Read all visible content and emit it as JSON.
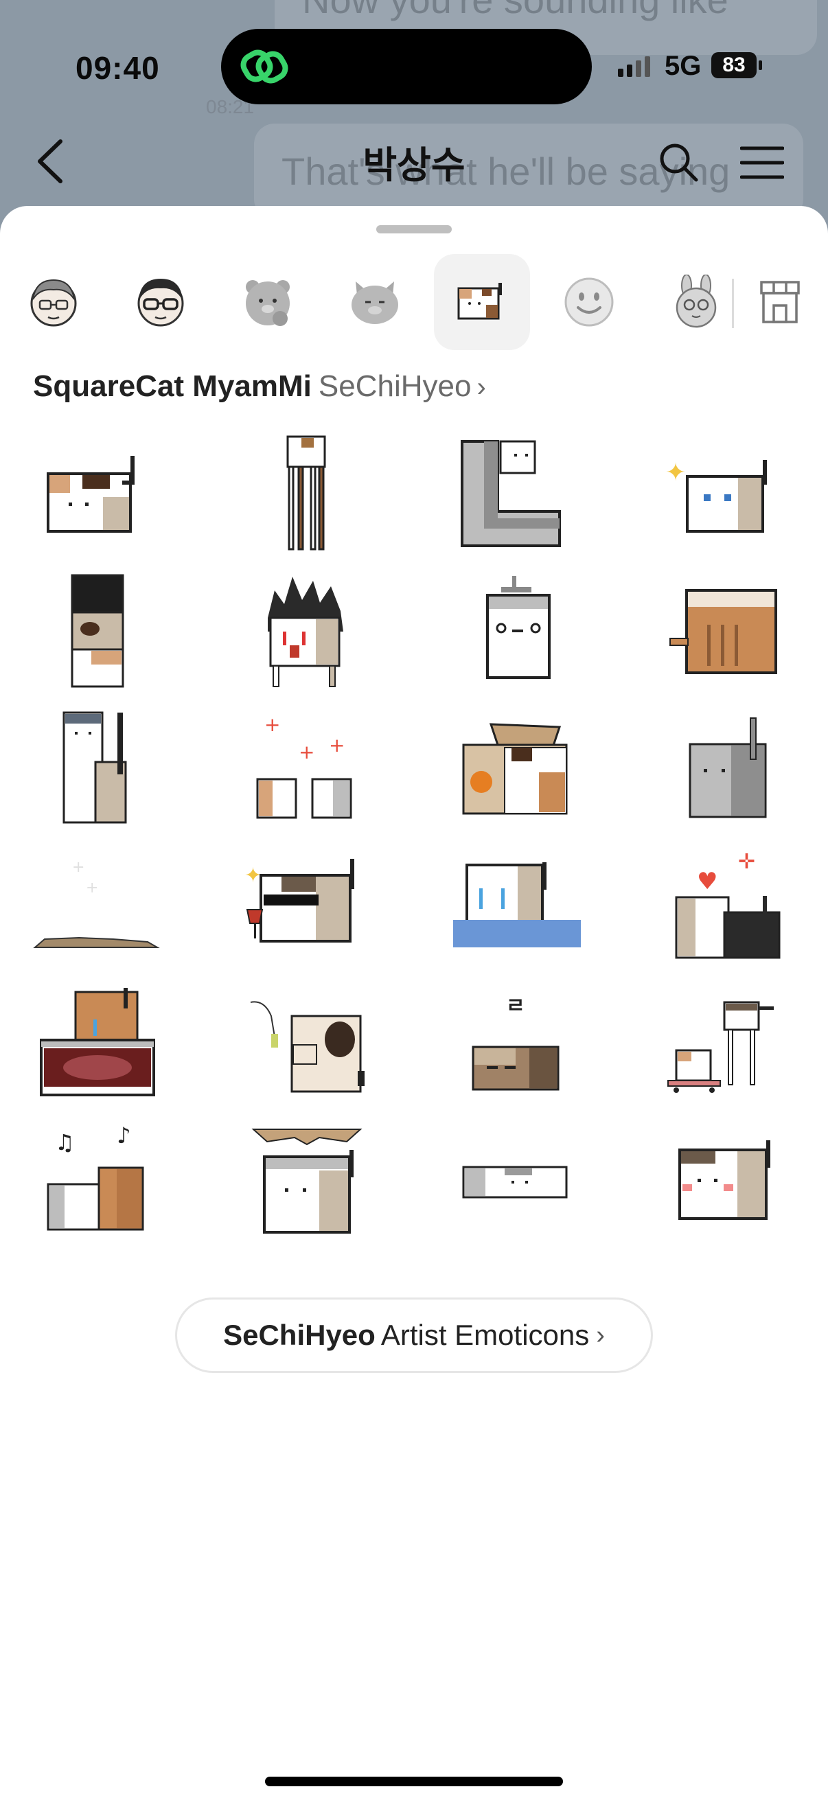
{
  "status_bar": {
    "time": "09:40",
    "network": "5G",
    "battery": "83"
  },
  "background_chat": {
    "message_1": "Now you're sounding like",
    "message_2": "That's what he'll be saying",
    "timestamp": "08:21"
  },
  "header": {
    "title": "박상수",
    "back_icon": "chevron-left-icon",
    "search_icon": "search-icon",
    "menu_icon": "hamburger-menu-icon"
  },
  "tabs": [
    {
      "name": "face-glasses-grey-hair",
      "active": false
    },
    {
      "name": "face-glasses-black-hair",
      "active": false
    },
    {
      "name": "bear-grey",
      "active": false
    },
    {
      "name": "cat-grey",
      "active": false
    },
    {
      "name": "squarecat",
      "active": true
    },
    {
      "name": "smiley",
      "active": false
    },
    {
      "name": "rabbit-grey",
      "active": false
    },
    {
      "name": "store",
      "active": false
    }
  ],
  "pack": {
    "title": "SquareCat MyamMi",
    "artist": "SeChiHyeo",
    "chevron": "›"
  },
  "stickers": [
    "cat-square-calico",
    "cat-tall-legs",
    "cat-stretched-L",
    "cat-sparkle-blue-eyes",
    "cat-stack-three",
    "cat-spiky-hair",
    "cat-shower",
    "cat-orange-box",
    "cat-long-neck",
    "cats-two-sparkle",
    "cat-in-box-orange",
    "cat-grey-tall-tail",
    "cat-flat-puddle",
    "cat-sunglasses-wine",
    "cat-crying-water",
    "cats-heart-black-white",
    "cat-in-tuna-can",
    "cat-toy-fishing",
    "cat-sleeping-z",
    "cats-skateboard",
    "cats-music-notes",
    "cat-hat-plate",
    "cat-flat-long",
    "cat-blush"
  ],
  "artist_button": {
    "name": "SeChiHyeo",
    "label": "Artist Emoticons",
    "chevron": "›"
  },
  "colors": {
    "sheet": "#ffffff",
    "overlay": "#8e9aa6",
    "active_tab": "#f2f2f2",
    "island_icon": "#38d46a"
  }
}
